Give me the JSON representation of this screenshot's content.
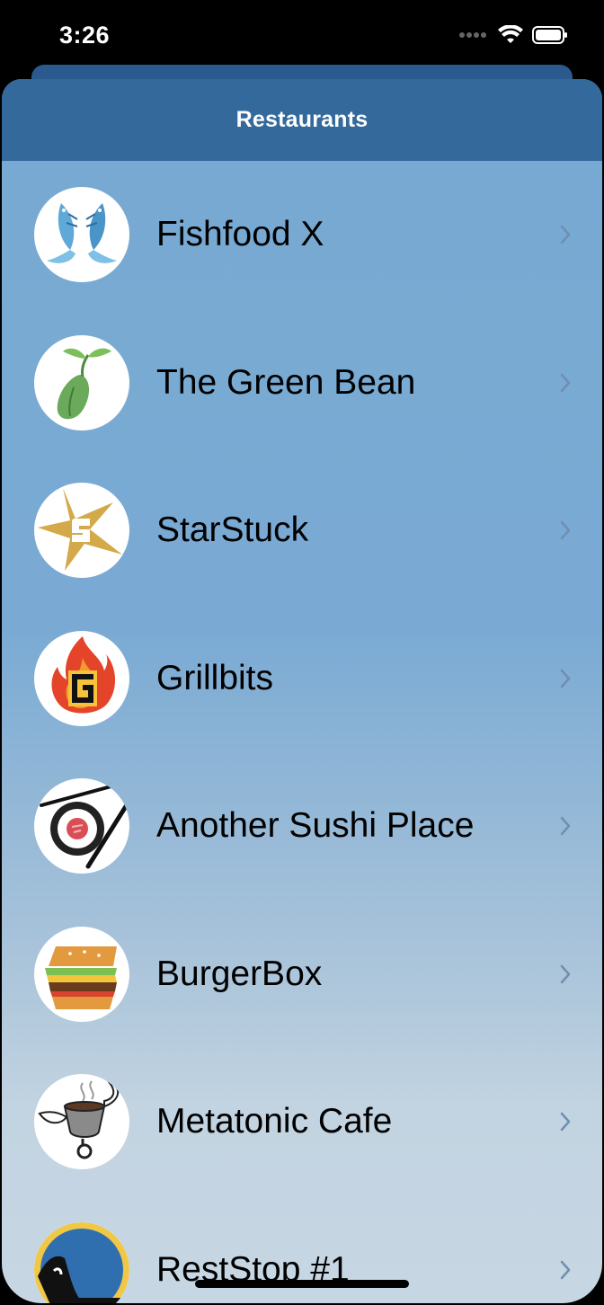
{
  "status_bar": {
    "time": "3:26",
    "icons": [
      "signal-dots-icon",
      "wifi-icon",
      "battery-icon"
    ]
  },
  "nav": {
    "title": "Restaurants"
  },
  "restaurants": [
    {
      "name": "Fishfood X",
      "icon": "fish-logo-icon"
    },
    {
      "name": "The Green Bean",
      "icon": "sprout-logo-icon"
    },
    {
      "name": "StarStuck",
      "icon": "star-logo-icon"
    },
    {
      "name": "Grillbits",
      "icon": "flame-logo-icon"
    },
    {
      "name": "Another Sushi Place",
      "icon": "sushi-logo-icon"
    },
    {
      "name": "BurgerBox",
      "icon": "burger-logo-icon"
    },
    {
      "name": "Metatonic Cafe",
      "icon": "coffee-cup-logo-icon"
    },
    {
      "name": "RestStop #1",
      "icon": "reststop-logo-icon"
    }
  ],
  "colors": {
    "nav": "#33699b",
    "list_top": "#77a9d2",
    "list_bottom": "#c7d6e3",
    "chevron": "#6f8fb0"
  }
}
